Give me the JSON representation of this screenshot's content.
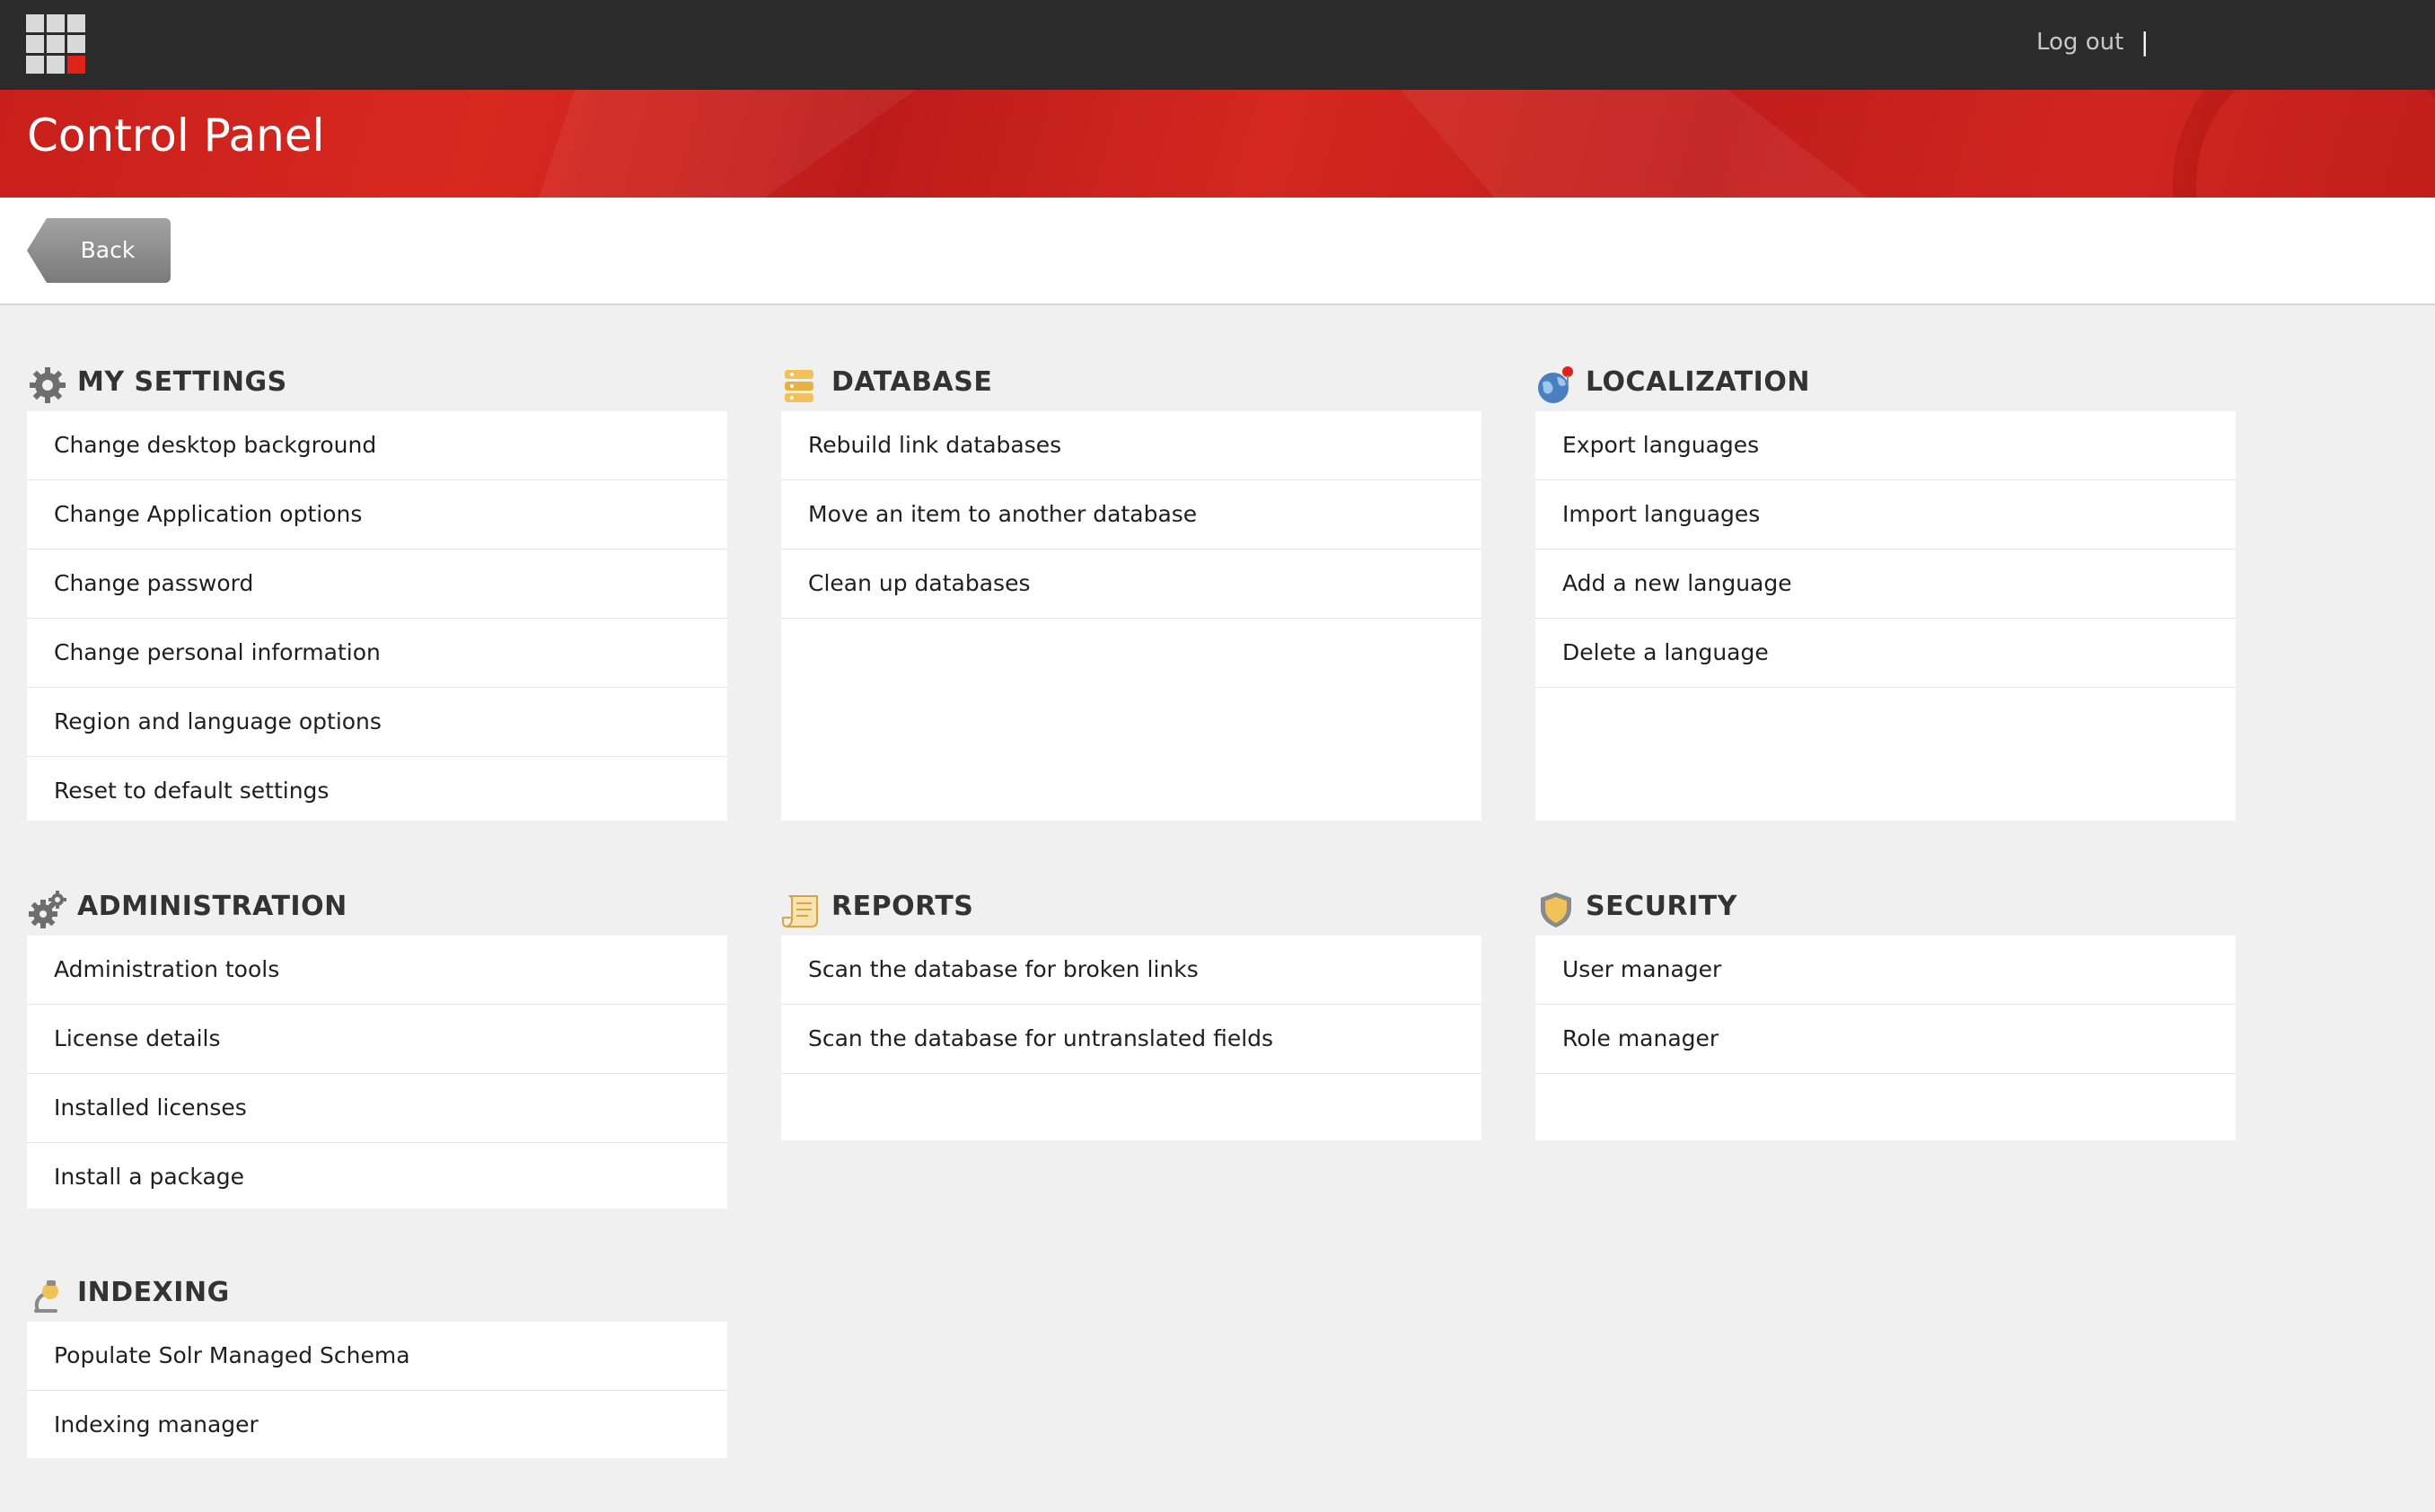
{
  "header": {
    "logout_label": "Log out",
    "separator": "|"
  },
  "banner": {
    "title": "Control Panel"
  },
  "toolbar": {
    "back_label": "Back"
  },
  "sections": {
    "my_settings": {
      "title": "MY SETTINGS",
      "icon": "gear-icon",
      "items": [
        "Change desktop background",
        "Change Application options",
        "Change password",
        "Change personal information",
        "Region and language options",
        "Reset to default settings"
      ]
    },
    "database": {
      "title": "DATABASE",
      "icon": "database-icon",
      "items": [
        "Rebuild link databases",
        "Move an item to another database",
        "Clean up databases"
      ]
    },
    "localization": {
      "title": "LOCALIZATION",
      "icon": "globe-icon",
      "items": [
        "Export languages",
        "Import languages",
        "Add a new language",
        "Delete a language"
      ]
    },
    "administration": {
      "title": "ADMINISTRATION",
      "icon": "gears-icon",
      "items": [
        "Administration tools",
        "License details",
        "Installed licenses",
        "Install a package"
      ]
    },
    "reports": {
      "title": "REPORTS",
      "icon": "scroll-icon",
      "items": [
        "Scan the database for broken links",
        "Scan the database for untranslated fields"
      ]
    },
    "security": {
      "title": "SECURITY",
      "icon": "shield-icon",
      "items": [
        "User manager",
        "Role manager"
      ]
    },
    "indexing": {
      "title": "INDEXING",
      "icon": "microscope-icon",
      "items": [
        "Populate Solr Managed Schema",
        "Indexing manager"
      ]
    }
  },
  "colors": {
    "topbar": "#2b2b2b",
    "banner_red": "#c81f1c",
    "page_bg": "#f0f0f0"
  }
}
